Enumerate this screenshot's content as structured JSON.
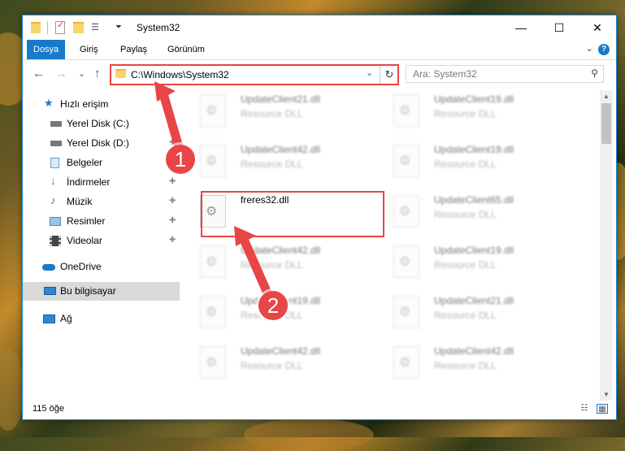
{
  "window": {
    "title": "System32",
    "minimize_glyph": "—",
    "maximize_glyph": "☐",
    "close_glyph": "✕"
  },
  "ribbon": {
    "tabs": [
      {
        "label": "Dosya",
        "active": true
      },
      {
        "label": "Giriş",
        "active": false
      },
      {
        "label": "Paylaş",
        "active": false
      },
      {
        "label": "Görünüm",
        "active": false
      }
    ],
    "help_glyph": "?",
    "expand_glyph": "⌄"
  },
  "navigation": {
    "back_glyph": "←",
    "forward_glyph": "→",
    "recent_glyph": "⌄",
    "up_glyph": "↑",
    "address": "C:\\Windows\\System32",
    "refresh_glyph": "↻",
    "dropdown_glyph": "⌄",
    "search_placeholder": "Ara: System32",
    "search_glyph": "⚲"
  },
  "sidebar": {
    "items": [
      {
        "label": "Hızlı erişim",
        "icon": "star-icon",
        "pinned": false
      },
      {
        "label": "Yerel Disk (C:)",
        "icon": "drive-icon",
        "pinned": true
      },
      {
        "label": "Yerel Disk (D:)",
        "icon": "drive-icon",
        "pinned": true
      },
      {
        "label": "Belgeler",
        "icon": "documents-icon",
        "pinned": true
      },
      {
        "label": "İndirmeler",
        "icon": "download-icon",
        "pinned": true
      },
      {
        "label": "Müzik",
        "icon": "music-icon",
        "pinned": true
      },
      {
        "label": "Resimler",
        "icon": "pictures-icon",
        "pinned": true
      },
      {
        "label": "Videolar",
        "icon": "videos-icon",
        "pinned": true
      },
      {
        "label": "OneDrive",
        "icon": "cloud-icon",
        "pinned": false
      },
      {
        "label": "Bu bilgisayar",
        "icon": "computer-icon",
        "pinned": false,
        "selected": true
      },
      {
        "label": "Ağ",
        "icon": "network-icon",
        "pinned": false
      }
    ],
    "pin_glyph": "📌"
  },
  "files": [
    {
      "name": "UpdateClient21.dll",
      "type": "Resource DLL",
      "blurred": true
    },
    {
      "name": "UpdateClient19.dll",
      "type": "Resource DLL",
      "blurred": true
    },
    {
      "name": "UpdateClient42.dll",
      "type": "Resource DLL",
      "blurred": true
    },
    {
      "name": "UpdateClient19.dll",
      "type": "Resource DLL",
      "blurred": true
    },
    {
      "name": "freres32.dll",
      "type": "",
      "blurred": false
    },
    {
      "name": "UpdateClient65.dll",
      "type": "Resource DLL",
      "blurred": true
    },
    {
      "name": "UpdateClient42.dll",
      "type": "Resource DLL",
      "blurred": true
    },
    {
      "name": "UpdateClient19.dll",
      "type": "Resource DLL",
      "blurred": true
    },
    {
      "name": "UpdateClient19.dll",
      "type": "Resource DLL",
      "blurred": true
    },
    {
      "name": "UpdateClient21.dll",
      "type": "Resource DLL",
      "blurred": true
    },
    {
      "name": "UpdateClient42.dll",
      "type": "Resource DLL",
      "blurred": true
    },
    {
      "name": "UpdateClient42.dll",
      "type": "Resource DLL",
      "blurred": true
    }
  ],
  "status": {
    "item_count": "115 öğe"
  },
  "annotations": {
    "step1": "1",
    "step2": "2",
    "highlight_color": "#e84546"
  }
}
